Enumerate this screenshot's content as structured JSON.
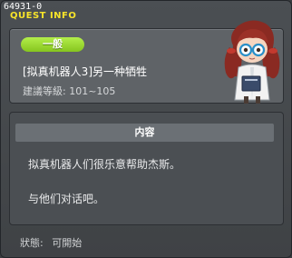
{
  "window": {
    "quest_id": "64931-0",
    "title": "QUEST INFO"
  },
  "summary": {
    "category": "一般",
    "quest_name": "[拟真机器人3]另一种牺牲",
    "level_label": "建議等級:",
    "level_range": "101~105"
  },
  "content": {
    "header": "内容",
    "lines": [
      "拟真机器人们很乐意帮助杰斯。",
      "与他们对话吧。"
    ]
  },
  "status": {
    "label": "狀態:",
    "value": "可開始"
  },
  "colors": {
    "title_yellow": "#f7e42a",
    "badge_green": "#86c51f",
    "panel_gray": "#5f6367"
  },
  "icons": {
    "portrait": "npc-portrait-icon"
  }
}
